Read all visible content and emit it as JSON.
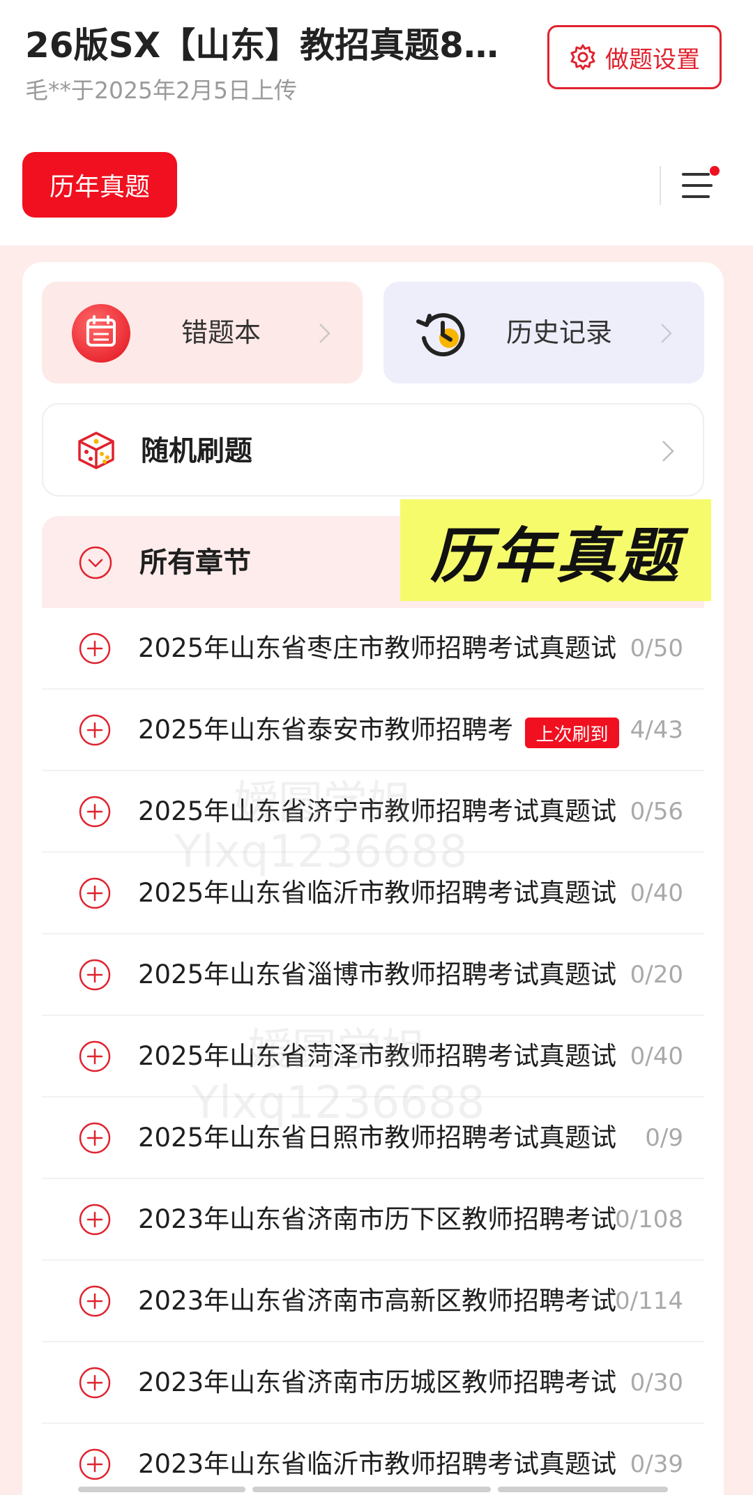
{
  "header": {
    "title": "26版SX【山东】教招真题81…",
    "meta": "毛**于2025年2月5日上传",
    "settings_label": "做题设置",
    "tab_label": "历年真题"
  },
  "quick_actions": {
    "wrong_book": "错题本",
    "history": "历史记录"
  },
  "random_practice": "随机刷题",
  "chapters": {
    "header": "所有章节",
    "banner": "历年真题",
    "last_badge": "上次刷到",
    "items": [
      {
        "title": "2025年山东省枣庄市教师招聘考试真题试",
        "count": "0/50"
      },
      {
        "title": "2025年山东省泰安市教师招聘考",
        "count": "4/43"
      },
      {
        "title": "2025年山东省济宁市教师招聘考试真题试",
        "count": "0/56"
      },
      {
        "title": "2025年山东省临沂市教师招聘考试真题试",
        "count": "0/40"
      },
      {
        "title": "2025年山东省淄博市教师招聘考试真题试",
        "count": "0/20"
      },
      {
        "title": "2025年山东省菏泽市教师招聘考试真题试",
        "count": "0/40"
      },
      {
        "title": "2025年山东省日照市教师招聘考试真题试",
        "count": "0/9"
      },
      {
        "title": "2023年山东省济南市历下区教师招聘考试",
        "count": "0/108"
      },
      {
        "title": "2023年山东省济南市高新区教师招聘考试",
        "count": "0/114"
      },
      {
        "title": "2023年山东省济南市历城区教师招聘考试",
        "count": "0/30"
      },
      {
        "title": "2023年山东省临沂市教师招聘考试真题试",
        "count": "0/39"
      }
    ]
  },
  "watermark": {
    "line1": "嫒圆学姐",
    "line2": "Ylxq1236688"
  },
  "colors": {
    "accent": "#f0101f",
    "pink_bg": "#fdecea",
    "banner_yellow": "#f6fb6c"
  }
}
